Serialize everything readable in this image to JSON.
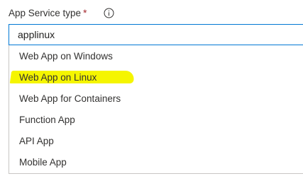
{
  "field": {
    "label": "App Service type",
    "required_marker": "*",
    "info_icon": "info-icon",
    "value": "applinux"
  },
  "dropdown": {
    "options": [
      {
        "label": "Web App on Windows",
        "highlighted": false
      },
      {
        "label": "Web App on Linux",
        "highlighted": true
      },
      {
        "label": "Web App for Containers",
        "highlighted": false
      },
      {
        "label": "Function App",
        "highlighted": false
      },
      {
        "label": "API App",
        "highlighted": false
      },
      {
        "label": "Mobile App",
        "highlighted": false
      }
    ],
    "highlight_color": "#f5f500"
  },
  "colors": {
    "focus_border": "#0078d4",
    "required": "#a4262c"
  }
}
